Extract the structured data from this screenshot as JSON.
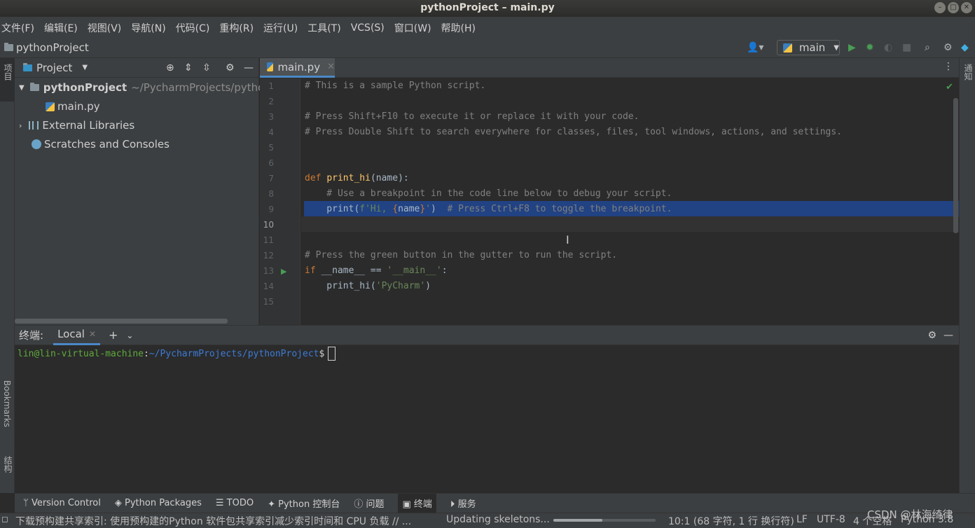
{
  "window": {
    "title": "pythonProject – main.py"
  },
  "menu": [
    "文件(F)",
    "编辑(E)",
    "视图(V)",
    "导航(N)",
    "代码(C)",
    "重构(R)",
    "运行(U)",
    "工具(T)",
    "VCS(S)",
    "窗口(W)",
    "帮助(H)"
  ],
  "navbar": {
    "project_name": "pythonProject",
    "run_config": "main"
  },
  "left_strip": {
    "project_label": "项目",
    "bookmarks_label": "Bookmarks",
    "structure_label": "结构"
  },
  "right_strip": {
    "notifications_label": "通知"
  },
  "project_panel": {
    "header": "Project",
    "tree": [
      {
        "label": "pythonProject",
        "path": "~/PycharmProjects/pythonP"
      },
      {
        "label": "main.py"
      },
      {
        "label": "External Libraries"
      },
      {
        "label": "Scratches and Consoles"
      }
    ]
  },
  "editor": {
    "tab_label": "main.py",
    "line_numbers": [
      "1",
      "2",
      "3",
      "4",
      "5",
      "6",
      "7",
      "8",
      "9",
      "10",
      "11",
      "12",
      "13",
      "14",
      "15"
    ],
    "lines": {
      "l1": "# This is a sample Python script.",
      "l3": "# Press Shift+F10 to execute it or replace it with your code.",
      "l4": "# Press Double Shift to search everywhere for classes, files, tool windows, actions, and settings.",
      "l7_kw": "def ",
      "l7_fn": "print_hi",
      "l7_rest": "(name):",
      "l8": "    # Use a breakpoint in the code line below to debug your script.",
      "l9_code": "    print(",
      "l9_str1": "f'Hi, ",
      "l9_brace1": "{",
      "l9_var": "name",
      "l9_brace2": "}",
      "l9_str2": "'",
      "l9_close": ")",
      "l9_comment": "  # Press Ctrl+F8 to toggle the breakpoint.",
      "l12": "# Press the green button in the gutter to run the script.",
      "l13_kw": "if ",
      "l13_mid": "__name__ == ",
      "l13_str": "'__main__'",
      "l13_end": ":",
      "l14_pre": "    print_hi(",
      "l14_str": "'PyCharm'",
      "l14_end": ")"
    }
  },
  "terminal": {
    "title": "终端:",
    "tab": "Local",
    "prompt_user": "lin@lin-virtual-machine",
    "prompt_sep": ":",
    "prompt_path": "~/PycharmProjects/pythonProject",
    "prompt_dollar": "$"
  },
  "toolwindows": [
    "Version Control",
    "Python Packages",
    "TODO",
    "Python 控制台",
    "问题",
    "终端",
    "服务"
  ],
  "status": {
    "message": "下载预构建共享索引: 使用预构建的Python 软件包共享索引减少索引时间和 CPU 负载 // ...",
    "task": "Updating skeletons...",
    "progress": 0.48,
    "position": "10:1 (68 字符, 1 行 换行符)",
    "line_sep": "LF",
    "encoding": "UTF-8",
    "indent": "4 个空格",
    "interpreter": "Python 3.8"
  },
  "watermark": "CSDN @林海绮律",
  "colors": {
    "accent": "#4a88c7",
    "selection": "#214283",
    "run_green": "#499c54"
  }
}
